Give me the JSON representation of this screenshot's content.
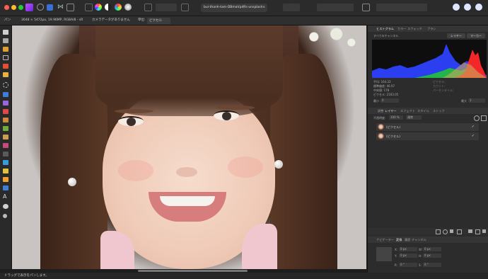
{
  "document": {
    "tab_title": "bui-thanh-tam-DBmaVpdRs-unsplash",
    "close_glyph": "×"
  },
  "context_toolbar": {
    "tool_name": "パン",
    "doc_info": "3648 × 5472px, 19.96MP, RGBA/8 - sR",
    "no_adjust": "カメラデータがありません",
    "unit_label": "単位:",
    "unit_value": "ピクセル"
  },
  "status_bar": {
    "text": "ドラッグで表示をパンします。"
  },
  "histogram_panel": {
    "tabs": [
      "ヒストグラム",
      "カラー",
      "スウォッチ",
      "ブラシ"
    ],
    "active_tab": 0,
    "channel_select": "すべてのチャンネル",
    "layer_btn": "レイヤー",
    "marker_btn": "マーカー",
    "stats_left": [
      "平均: 164.32",
      "標準偏差: 46.97",
      "中央値: 178",
      "ピクセル: 2163.05"
    ],
    "stats_right": [
      "ピクセル:",
      "カウント:",
      "パーセンタイル:"
    ],
    "min_label": "最小",
    "min_value": "0",
    "max_label": "最大",
    "max_value": "1"
  },
  "layers_panel": {
    "tabs": [
      "調整",
      "レイヤー",
      "エフェクト",
      "スタイル",
      "ストック"
    ],
    "active_tab": 1,
    "opacity_label": "不透明度:",
    "opacity_value": "100 %",
    "blend_mode": "通常",
    "layers": [
      {
        "name": "(ピクセル)",
        "checked": "✓"
      },
      {
        "name": "(ピクセル)",
        "checked": "✓"
      }
    ]
  },
  "navigator_panel": {
    "tabs": [
      "ナビゲーター",
      "変換",
      "履歴",
      "チャンネル"
    ],
    "active_tab": 1,
    "fields": [
      {
        "label": "X:",
        "value": "0 px"
      },
      {
        "label": "W:",
        "value": "0 px"
      },
      {
        "label": "Y:",
        "value": "0 px"
      },
      {
        "label": "H:",
        "value": "0 px"
      },
      {
        "label": "R:",
        "value": "0 °"
      },
      {
        "label": "S:",
        "value": "0 °"
      }
    ]
  },
  "colors": {
    "accent": "#4d8cff",
    "histo_blue": "#2b3ef0",
    "histo_green": "#22c23a",
    "histo_red": "#ff2a2a"
  }
}
